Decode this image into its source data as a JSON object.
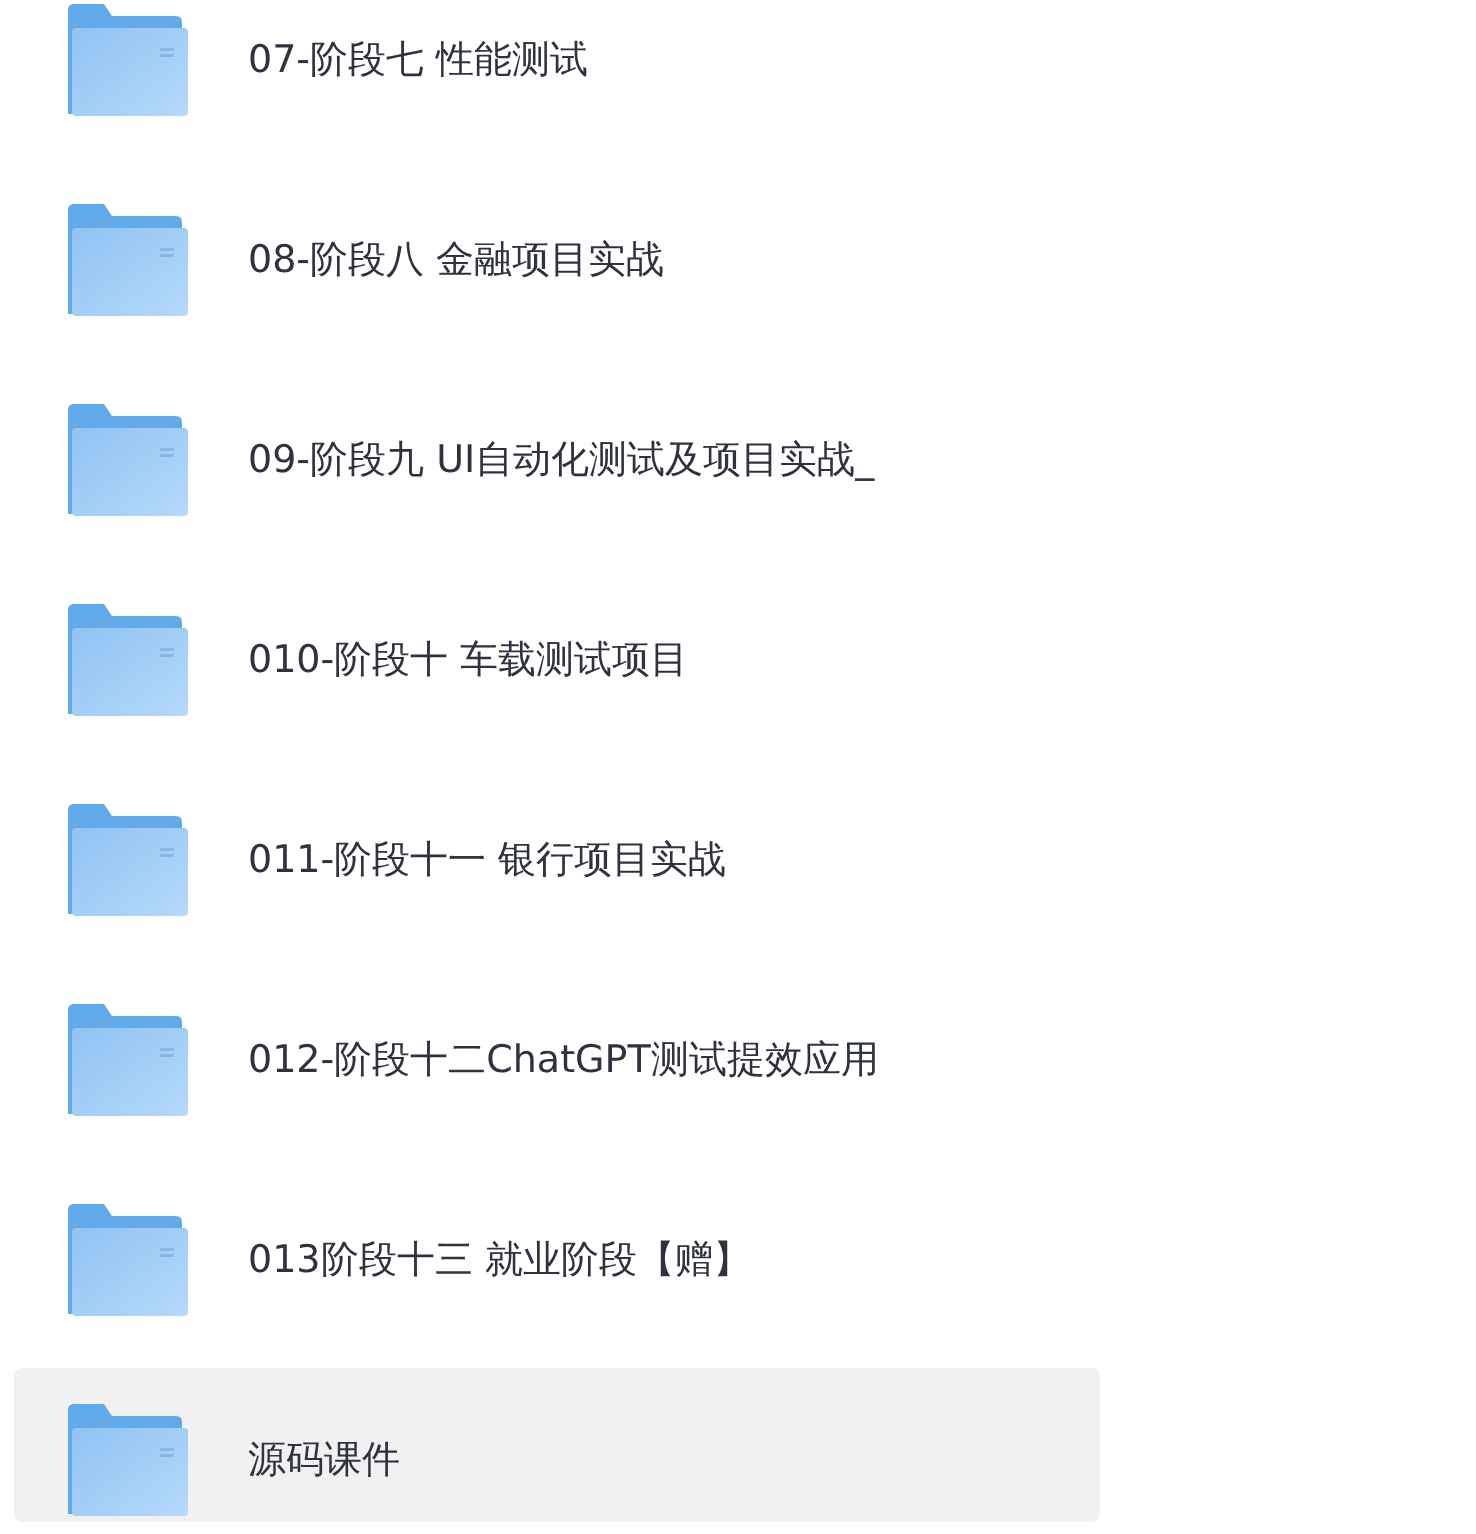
{
  "folders": [
    {
      "name": "07-阶段七 性能测试",
      "selected": false
    },
    {
      "name": "08-阶段八 金融项目实战",
      "selected": false
    },
    {
      "name": "09-阶段九 UI自动化测试及项目实战_",
      "selected": false
    },
    {
      "name": "010-阶段十 车载测试项目",
      "selected": false
    },
    {
      "name": "011-阶段十一 银行项目实战",
      "selected": false
    },
    {
      "name": "012-阶段十二ChatGPT测试提效应用",
      "selected": false
    },
    {
      "name": "013阶段十三 就业阶段【赠】",
      "selected": false
    },
    {
      "name": "源码课件",
      "selected": true
    }
  ]
}
